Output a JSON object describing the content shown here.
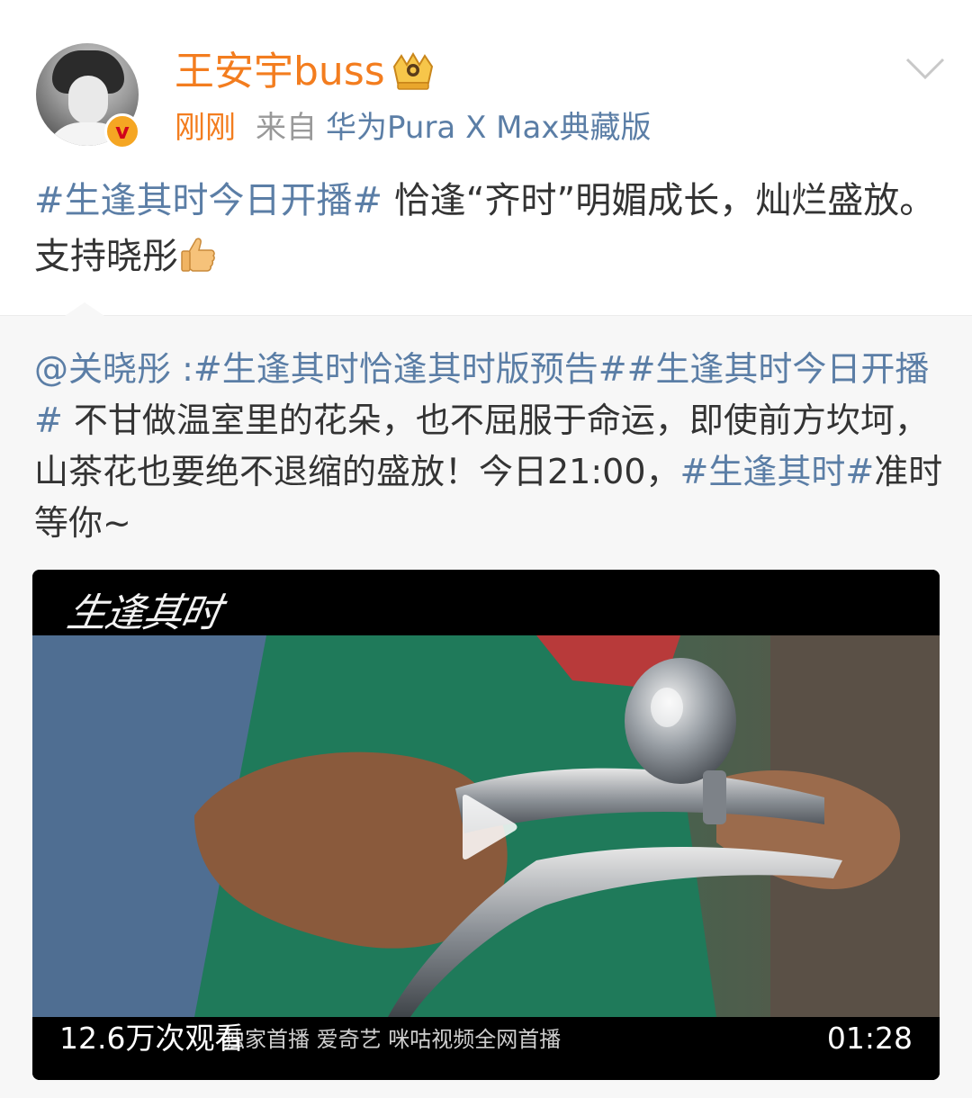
{
  "post": {
    "username": "王安宇buss",
    "time": "刚刚",
    "source_prefix": "来自",
    "device": "华为Pura X Max典藏版",
    "text_hashtag": "#生逢其时今日开播#",
    "text_body": " 恰逢“齐时”明媚成长，灿烂盛放。支持晓彤"
  },
  "repost": {
    "mention": "@关晓彤",
    "separator": " :",
    "hashtag_1": "#生逢其时恰逢其时版预告#",
    "hashtag_2": "#生逢其时今日开播#",
    "body": " 不甘做温室里的花朵，也不屈服于命运，即使前方坎坷，山茶花也要绝不退缩的盛放！今日21:00，",
    "hashtag_3": "#生逢其时#",
    "tail": "准时等你~"
  },
  "video": {
    "title_logo": "生逢其时",
    "subtitle_strip": "独家首播  爱奇艺  咪咕视频全网首播",
    "view_count": "12.6万次观看",
    "duration": "01:28"
  },
  "colors": {
    "accent_orange": "#f37d1f",
    "link_blue": "#5b7ea6",
    "text": "#333333",
    "meta_gray": "#999999",
    "repost_bg": "#f7f7f7"
  },
  "icons": {
    "crown": "crown-icon",
    "verified": "verified-badge-icon",
    "chevron": "chevron-down-icon",
    "thumbs_up": "thumbs-up-icon",
    "play": "play-icon"
  }
}
